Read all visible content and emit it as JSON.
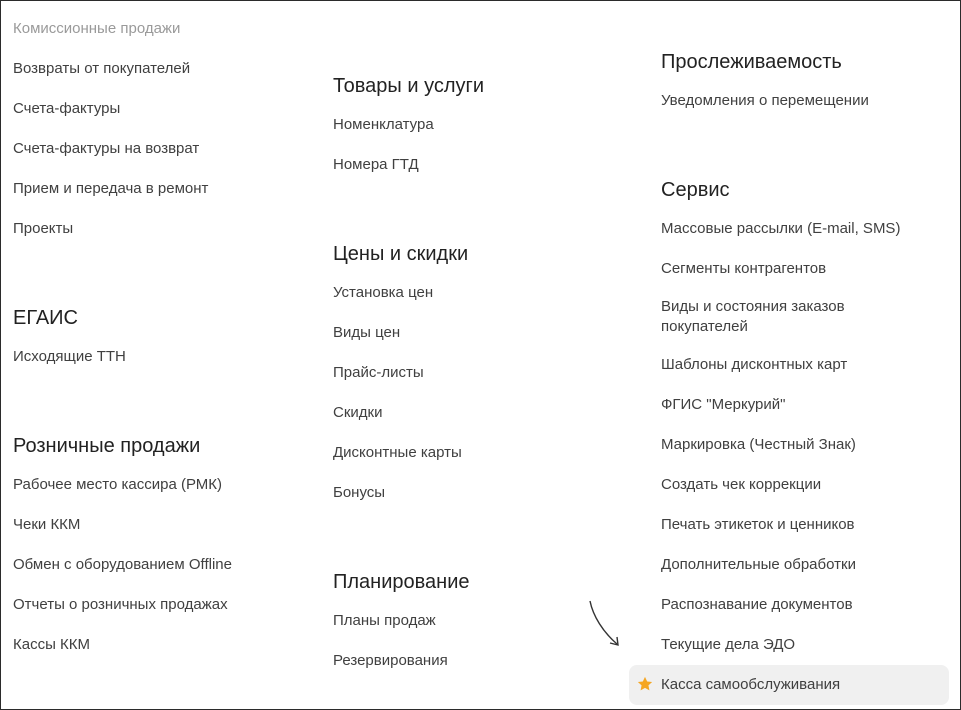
{
  "column1": {
    "items_top": [
      {
        "label": "Комиссионные продажи"
      },
      {
        "label": "Возвраты от покупателей"
      },
      {
        "label": "Счета-фактуры"
      },
      {
        "label": "Счета-фактуры на возврат"
      },
      {
        "label": "Прием и передача в ремонт"
      },
      {
        "label": "Проекты"
      }
    ],
    "egais": {
      "heading": "ЕГАИС",
      "items": [
        {
          "label": "Исходящие ТТН"
        }
      ]
    },
    "retail": {
      "heading": "Розничные продажи",
      "items": [
        {
          "label": "Рабочее место кассира (РМК)"
        },
        {
          "label": "Чеки ККМ"
        },
        {
          "label": "Обмен с оборудованием Offline"
        },
        {
          "label": "Отчеты о розничных продажах"
        },
        {
          "label": "Кассы ККМ"
        }
      ]
    }
  },
  "column2": {
    "goods": {
      "heading": "Товары и услуги",
      "items": [
        {
          "label": "Номенклатура"
        },
        {
          "label": "Номера ГТД"
        }
      ]
    },
    "prices": {
      "heading": "Цены и скидки",
      "items": [
        {
          "label": "Установка цен"
        },
        {
          "label": "Виды цен"
        },
        {
          "label": "Прайс-листы"
        },
        {
          "label": "Скидки"
        },
        {
          "label": "Дисконтные карты"
        },
        {
          "label": "Бонусы"
        }
      ]
    },
    "planning": {
      "heading": "Планирование",
      "items": [
        {
          "label": "Планы продаж"
        },
        {
          "label": "Резервирования"
        }
      ]
    }
  },
  "column3": {
    "traceability": {
      "heading": "Прослеживаемость",
      "items": [
        {
          "label": "Уведомления о перемещении"
        }
      ]
    },
    "service": {
      "heading": "Сервис",
      "items": [
        {
          "label": "Массовые рассылки (E-mail, SMS)"
        },
        {
          "label": "Сегменты контрагентов"
        },
        {
          "label": "Виды и состояния заказов покупателей"
        },
        {
          "label": "Шаблоны дисконтных карт"
        },
        {
          "label": "ФГИС \"Меркурий\""
        },
        {
          "label": "Маркировка (Честный Знак)"
        },
        {
          "label": "Создать чек коррекции"
        },
        {
          "label": "Печать этикеток и ценников"
        },
        {
          "label": "Дополнительные обработки"
        },
        {
          "label": "Распознавание документов"
        },
        {
          "label": "Текущие дела ЭДО"
        }
      ],
      "highlighted": {
        "label": "Касса самообслуживания",
        "icon": "star-icon",
        "star_color": "#f5a623"
      }
    }
  }
}
